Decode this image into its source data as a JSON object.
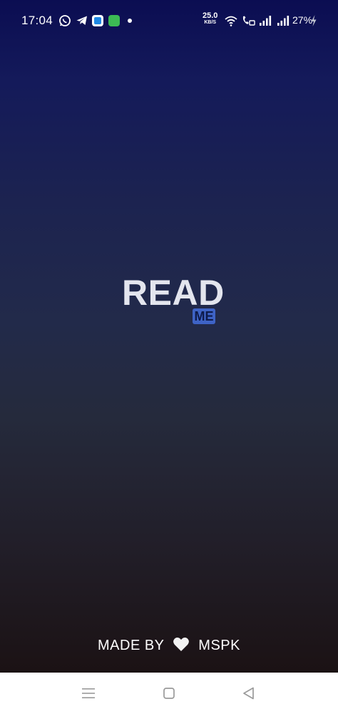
{
  "status_bar": {
    "time": "17:04",
    "net_speed_value": "25.0",
    "net_speed_unit": "KB/S",
    "battery": "27%",
    "icons": [
      "whatsapp-icon",
      "telegram-icon",
      "app-icon",
      "app-icon",
      "notification-dot",
      "wifi-icon",
      "volte-icon",
      "signal-icon",
      "signal-icon",
      "charging-icon"
    ]
  },
  "logo": {
    "main": "READ",
    "badge": "ME",
    "badge_color": "#3e63c6"
  },
  "footer": {
    "made_by": "MADE BY",
    "author": "MSPK"
  },
  "nav_bar": {
    "buttons": [
      "menu-icon",
      "home-icon",
      "back-icon"
    ]
  }
}
